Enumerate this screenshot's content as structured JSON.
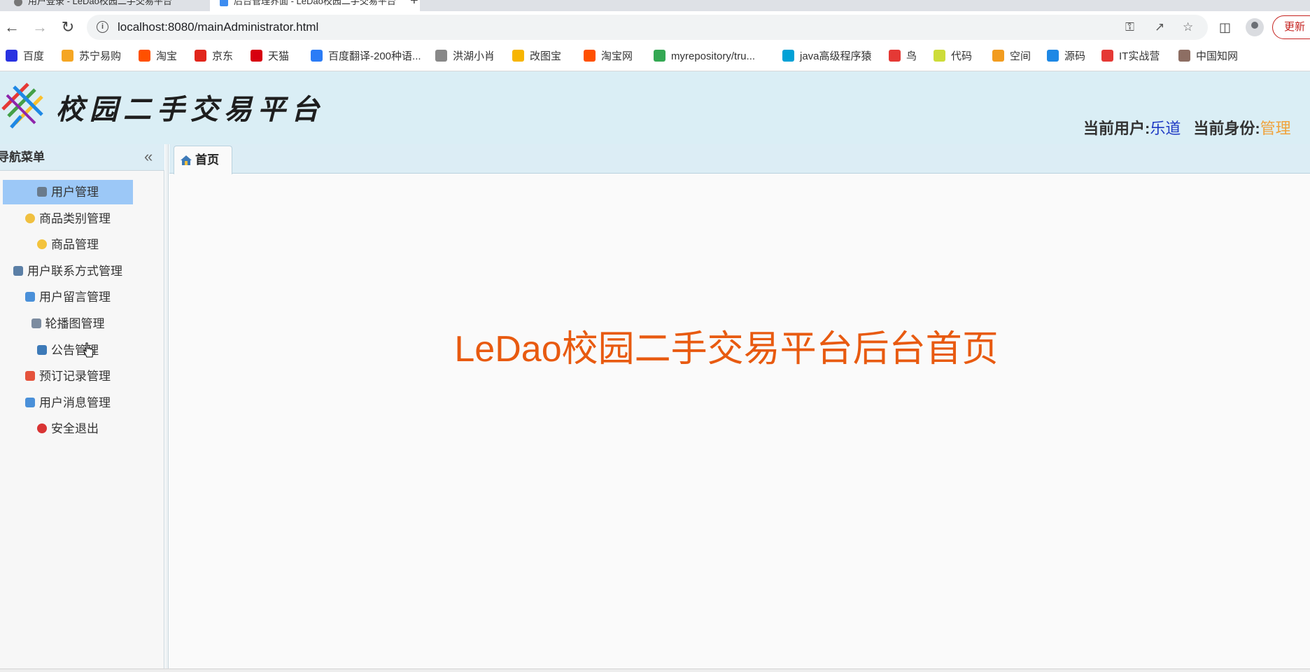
{
  "browser": {
    "tabs": [
      {
        "label": "用户登录 - LeDao校园二手交易平台"
      },
      {
        "label": "后台管理界面 - LeDao校园二手交易平台"
      }
    ],
    "url": "localhost:8080/mainAdministrator.html",
    "update_label": "更新",
    "bookmarks": [
      {
        "label": "百度",
        "color": "#2932e1"
      },
      {
        "label": "苏宁易购",
        "color": "#f5a623"
      },
      {
        "label": "淘宝",
        "color": "#ff5000"
      },
      {
        "label": "京东",
        "color": "#e1251b"
      },
      {
        "label": "天猫",
        "color": "#d7000f"
      },
      {
        "label": "百度翻译-200种语...",
        "color": "#2b7cf6"
      },
      {
        "label": "洪湖小肖",
        "color": "#888888"
      },
      {
        "label": "改图宝",
        "color": "#f7b500"
      },
      {
        "label": "淘宝网",
        "color": "#ff5000"
      },
      {
        "label": "myrepository/tru...",
        "color": "#34a853"
      },
      {
        "label": "java高级程序猿",
        "color": "#00a1d6"
      },
      {
        "label": "鸟",
        "color": "#e53935"
      },
      {
        "label": "代码",
        "color": "#cddc39"
      },
      {
        "label": "空间",
        "color": "#f29c1f"
      },
      {
        "label": "源码",
        "color": "#1e88e5"
      },
      {
        "label": "IT实战营",
        "color": "#e53935"
      },
      {
        "label": "中国知网",
        "color": "#8d6e63"
      }
    ]
  },
  "header": {
    "logo_text": "校园二手交易平台",
    "current_user_label": "当前用户:",
    "current_user": "乐道",
    "current_role_label": "当前身份:",
    "current_role": "管理"
  },
  "sidebar": {
    "title": "导航菜单",
    "items": [
      {
        "label": "用户管理",
        "icon": "user-icon",
        "color": "#6a7b8c"
      },
      {
        "label": "商品类别管理",
        "icon": "gear-icon",
        "color": "#f0c040"
      },
      {
        "label": "商品管理",
        "icon": "star-icon",
        "color": "#f3c33c"
      },
      {
        "label": "用户联系方式管理",
        "icon": "phone-icon",
        "color": "#5b7fa6"
      },
      {
        "label": "用户留言管理",
        "icon": "comments-icon",
        "color": "#4a90d9"
      },
      {
        "label": "轮播图管理",
        "icon": "images-icon",
        "color": "#7c8ca0"
      },
      {
        "label": "公告管理",
        "icon": "board-icon",
        "color": "#3d7ab8"
      },
      {
        "label": "预订记录管理",
        "icon": "calendar-icon",
        "color": "#e5533c"
      },
      {
        "label": "用户消息管理",
        "icon": "comment-icon",
        "color": "#4a90d9"
      },
      {
        "label": "安全退出",
        "icon": "power-icon",
        "color": "#d93434"
      }
    ]
  },
  "main": {
    "tab_label": "首页",
    "welcome": "LeDao校园二手交易平台后台首页"
  }
}
